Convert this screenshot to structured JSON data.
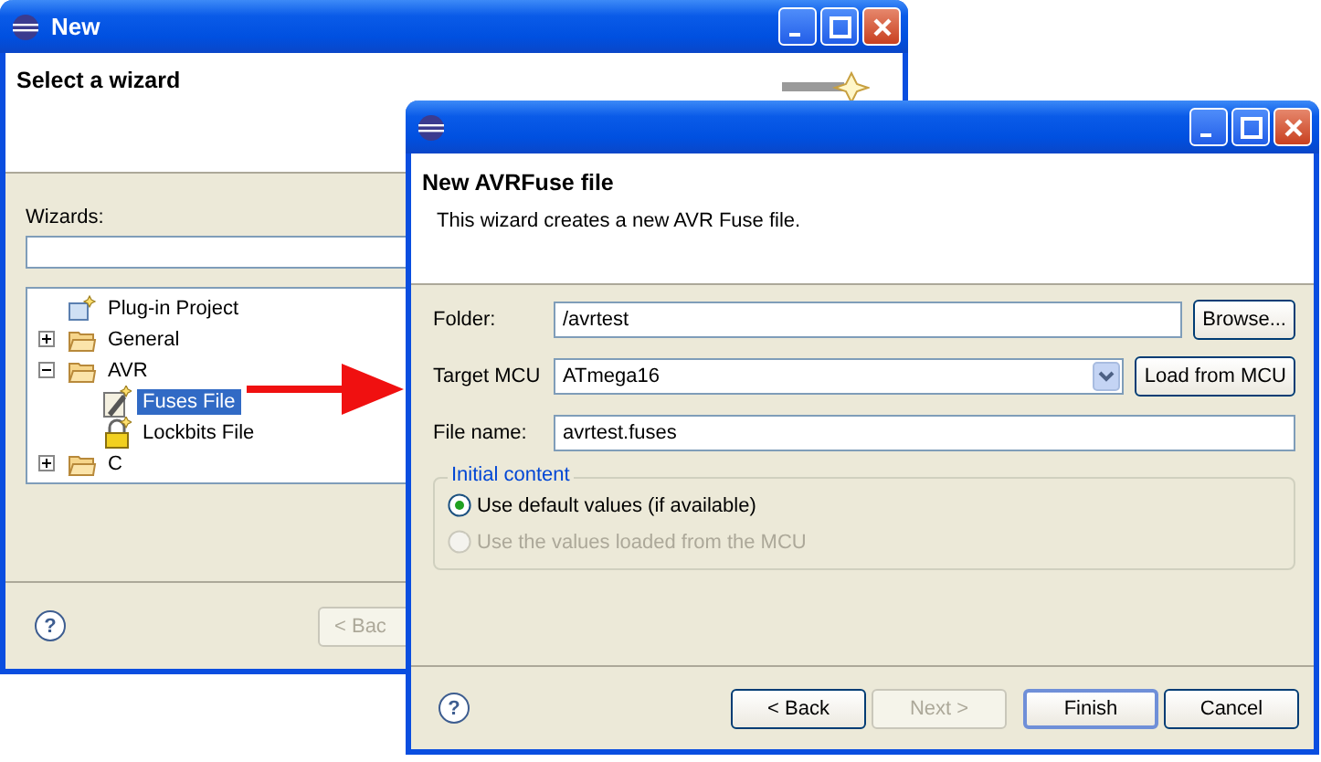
{
  "back_window": {
    "title": "New",
    "heading": "Select a wizard",
    "wizards_label": "Wizards:",
    "tree": [
      {
        "label": "Plug-in Project",
        "kind": "wizard",
        "selected": false
      },
      {
        "label": "General",
        "kind": "folder",
        "expanded": false,
        "selected": false
      },
      {
        "label": "AVR",
        "kind": "folder",
        "expanded": true,
        "selected": false,
        "children": [
          {
            "label": "Fuses File",
            "kind": "fuses",
            "selected": true
          },
          {
            "label": "Lockbits File",
            "kind": "lock",
            "selected": false
          }
        ]
      },
      {
        "label": "C",
        "kind": "folder",
        "expanded": false,
        "selected": false
      }
    ],
    "back_button": "< Bac",
    "help": "?"
  },
  "front_window": {
    "heading": "New AVRFuse file",
    "description": "This wizard creates a new AVR Fuse file.",
    "fields": [
      {
        "label": "Folder:",
        "value": "/avrtest",
        "kind": "text",
        "button": "Browse..."
      },
      {
        "label": "Target MCU",
        "value": "ATmega16",
        "kind": "dropdown",
        "button": "Load from MCU"
      },
      {
        "label": "File name:",
        "value": "avrtest.fuses",
        "kind": "text"
      }
    ],
    "group": {
      "title": "Initial content",
      "options": [
        {
          "label": "Use default values (if available)",
          "selected": true,
          "disabled": false
        },
        {
          "label": "Use the values loaded from the MCU",
          "selected": false,
          "disabled": true
        }
      ]
    },
    "help": "?",
    "buttons": [
      {
        "label": "< Back",
        "disabled": false,
        "default": false
      },
      {
        "label": "Next >",
        "disabled": true,
        "default": false
      },
      {
        "label": "Finish",
        "disabled": false,
        "default": true
      },
      {
        "label": "Cancel",
        "disabled": false,
        "default": false
      }
    ]
  }
}
